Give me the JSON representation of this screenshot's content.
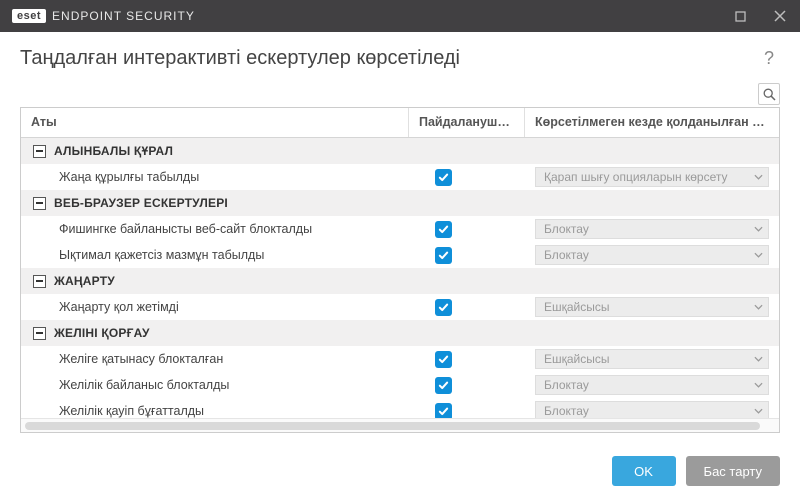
{
  "brand": {
    "badge": "eset",
    "product": "ENDPOINT SECURITY"
  },
  "header": {
    "title": "Таңдалған интерактивті ескертулер көрсетіледі"
  },
  "columns": {
    "name": "Аты",
    "ask": "Пайдаланушыд...",
    "action": "Көрсетілмеген кезде қолданылған әрекет"
  },
  "groups": [
    {
      "label": "АЛЫНБАЛЫ ҚҰРАЛ",
      "rows": [
        {
          "name": "Жаңа құрылғы табылды",
          "checked": true,
          "action": "Қарап шығу опцияларын көрсету"
        }
      ]
    },
    {
      "label": "ВЕБ-БРАУЗЕР ЕСКЕРТУЛЕРІ",
      "rows": [
        {
          "name": "Фишингке байланысты веб-сайт блокталды",
          "checked": true,
          "action": "Блоктау"
        },
        {
          "name": "Ықтимал қажетсіз мазмұн табылды",
          "checked": true,
          "action": "Блоктау"
        }
      ]
    },
    {
      "label": "ЖАҢАРТУ",
      "rows": [
        {
          "name": "Жаңарту қол жетімді",
          "checked": true,
          "action": "Ешқайсысы"
        }
      ]
    },
    {
      "label": "ЖЕЛІНІ ҚОРҒАУ",
      "rows": [
        {
          "name": "Желіге қатынасу блокталған",
          "checked": true,
          "action": "Ешқайсысы"
        },
        {
          "name": "Желілік байланыс блокталды",
          "checked": true,
          "action": "Блоктау"
        },
        {
          "name": "Желілік қауіп бұғатталды",
          "checked": true,
          "action": "Блоктау"
        }
      ]
    }
  ],
  "footer": {
    "ok": "OK",
    "cancel": "Бас тарту"
  }
}
